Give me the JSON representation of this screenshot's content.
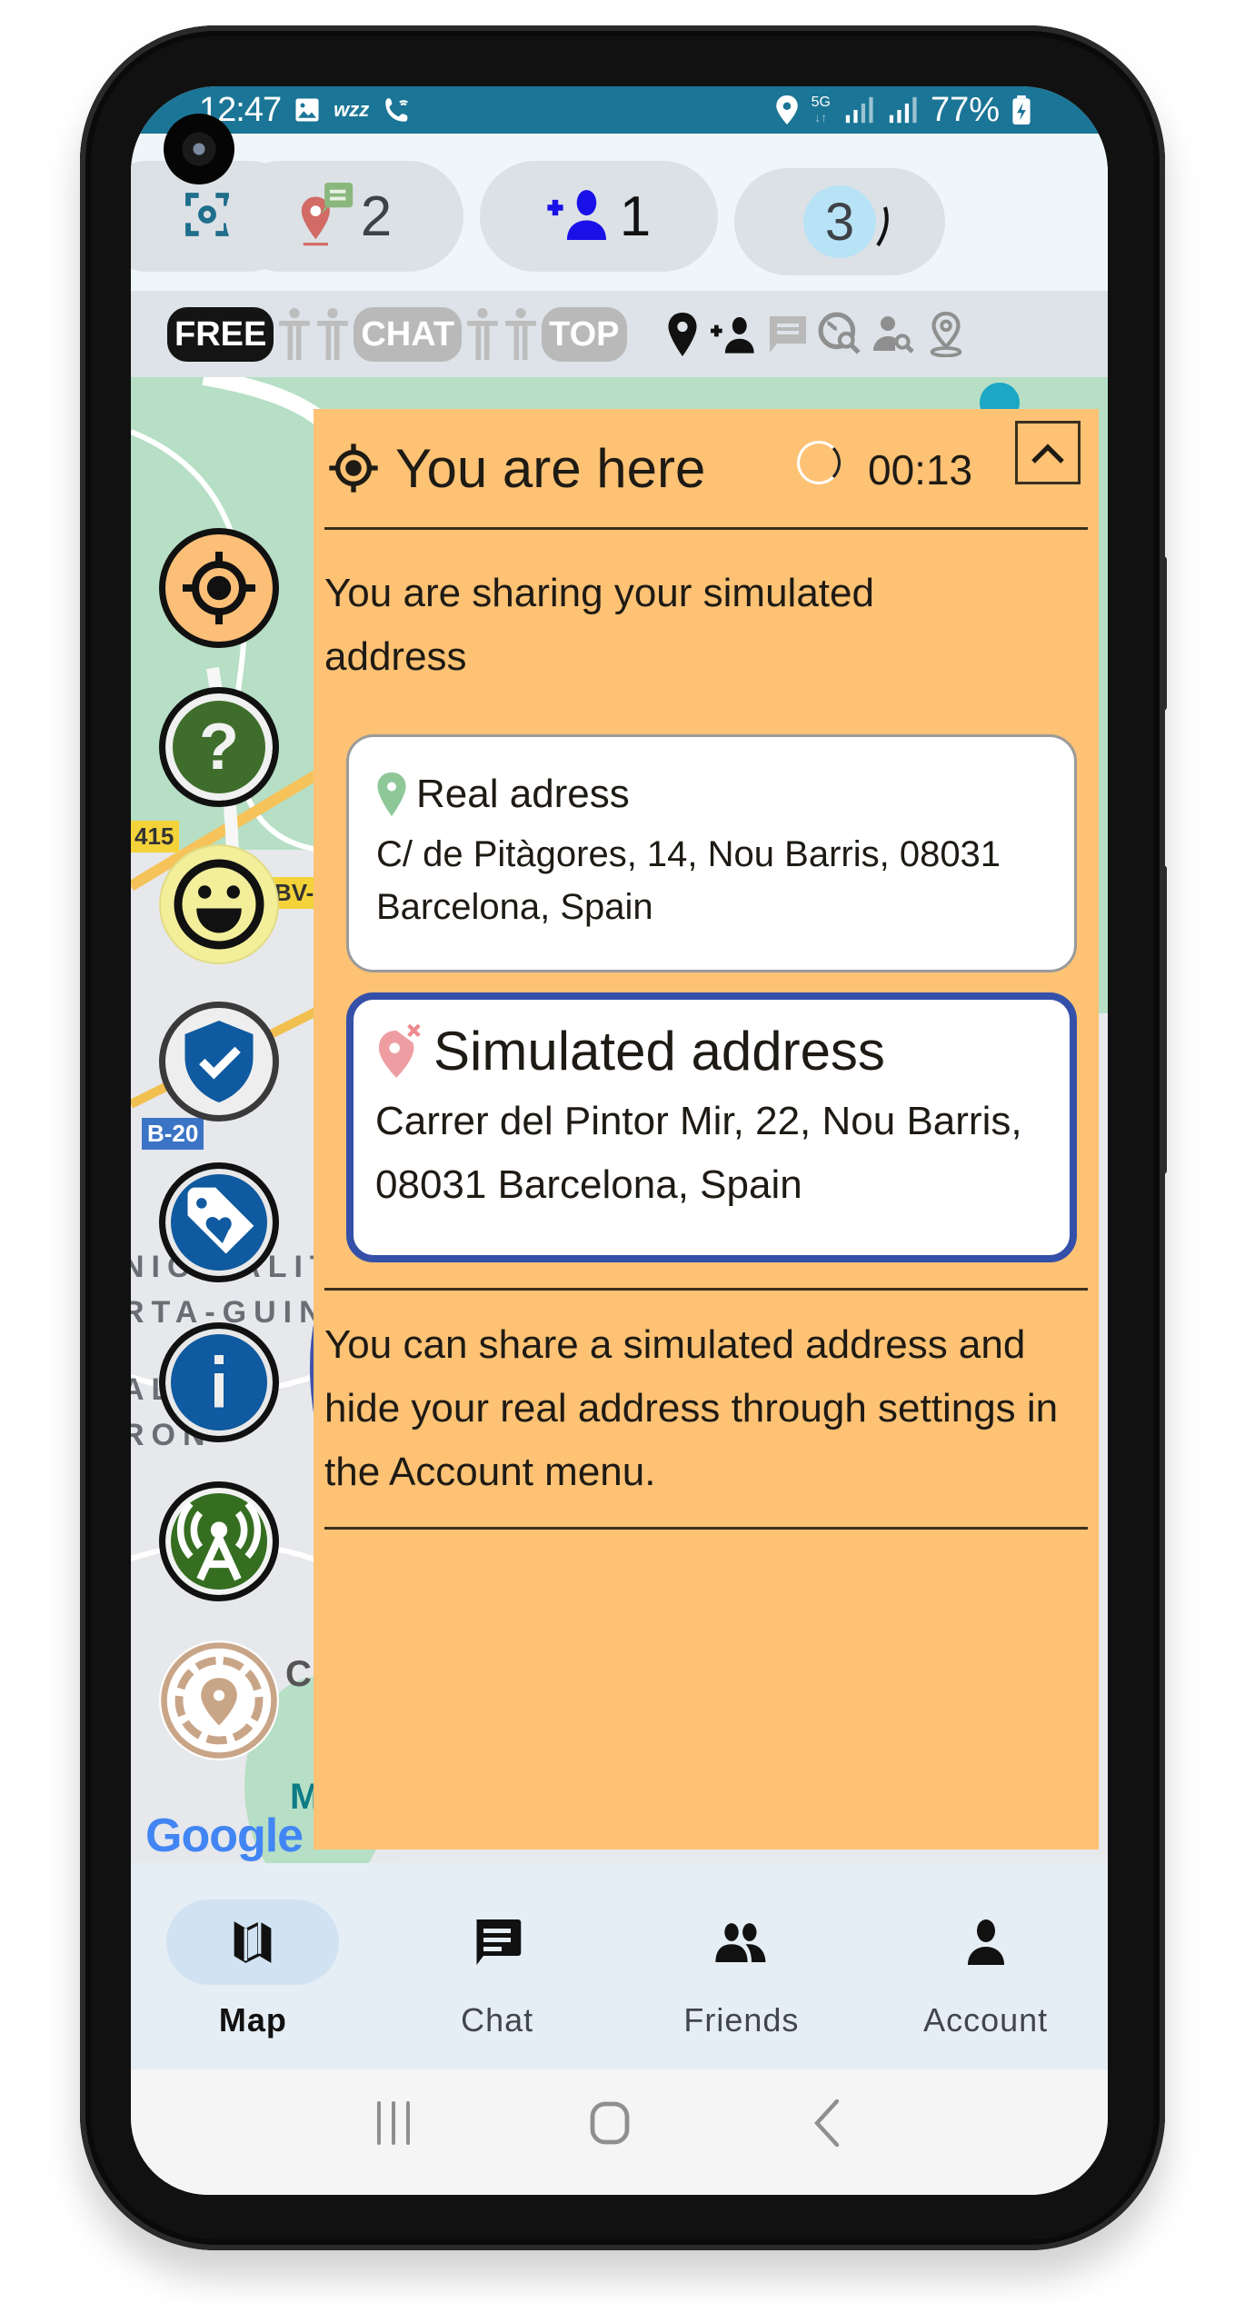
{
  "status_bar": {
    "time": "12:47",
    "left_icons": [
      "image-icon",
      "wzz-icon",
      "wifi-call-icon"
    ],
    "wzz_text": "wzz",
    "right_icons": [
      "location-icon",
      "5g-icon",
      "signal-icon",
      "signal-icon"
    ],
    "network": "5G",
    "battery": "77%"
  },
  "action_row": {
    "buttons": [
      {
        "name": "scan",
        "icon": "scan-icon",
        "count": ""
      },
      {
        "name": "location-messages",
        "icon": "location-chat-icon",
        "count": "2"
      },
      {
        "name": "friend-requests",
        "icon": "add-person-icon",
        "count": "1"
      },
      {
        "name": "online",
        "icon": "progress-badge",
        "count": "3"
      }
    ]
  },
  "filter_row": {
    "tags": [
      {
        "label": "FREE",
        "active": true
      },
      {
        "label": "CHAT",
        "active": false
      },
      {
        "label": "TOP",
        "active": false
      }
    ],
    "icons": [
      "pin-icon",
      "add-person-icon",
      "message-icon",
      "globe-search-icon",
      "person-search-icon",
      "place-outline-icon"
    ]
  },
  "map": {
    "labels": [
      "NICIPALIT",
      "RTA-GUIN",
      "AL",
      "RON"
    ],
    "road_tags": [
      "415",
      "BV-",
      "B-20"
    ],
    "poi_letters": [
      "C",
      "M"
    ],
    "attribution": "Google",
    "map_side_letters": [
      "3",
      "A"
    ]
  },
  "side_buttons": [
    {
      "name": "locate-me",
      "icon": "target-icon",
      "color": "#fbbf78"
    },
    {
      "name": "help",
      "icon": "question-icon",
      "color": "#3f6e2c"
    },
    {
      "name": "mood",
      "icon": "smiley-icon",
      "color": "#f2ee9a"
    },
    {
      "name": "security",
      "icon": "shield-check-icon",
      "color": "#0f5aa0"
    },
    {
      "name": "favorites",
      "icon": "tag-heart-icon",
      "color": "#0f5aa0"
    },
    {
      "name": "info",
      "icon": "info-icon",
      "color": "#0f5aa0"
    },
    {
      "name": "broadcast",
      "icon": "antenna-icon",
      "color": "#356e20"
    },
    {
      "name": "location-radius",
      "icon": "location-radius-icon",
      "color": "#c9a588"
    }
  ],
  "panel": {
    "title": "You are here",
    "timer": "00:13",
    "sharing_text": "You are sharing your simulated address",
    "real_card": {
      "title": "Real adress",
      "address": "C/ de Pitàgores, 14, Nou Barris, 08031 Barcelona, Spain"
    },
    "simulated_card": {
      "title": "Simulated address",
      "address": "Carrer del Pintor Mir, 22, Nou Barris, 08031 Barcelona, Spain",
      "selected": true
    },
    "note": "You can share a simulated address and hide your real address through settings in the Account menu."
  },
  "bottom_nav": {
    "items": [
      {
        "label": "Map",
        "icon": "map-icon",
        "active": true
      },
      {
        "label": "Chat",
        "icon": "chat-icon",
        "active": false
      },
      {
        "label": "Friends",
        "icon": "friends-icon",
        "active": false
      },
      {
        "label": "Account",
        "icon": "account-icon",
        "active": false
      }
    ]
  },
  "colors": {
    "status_bar": "#1b7596",
    "panel_bg": "#fdc274",
    "simulated_border": "#3450a9",
    "nav_active_bg": "#d1e3f2"
  }
}
